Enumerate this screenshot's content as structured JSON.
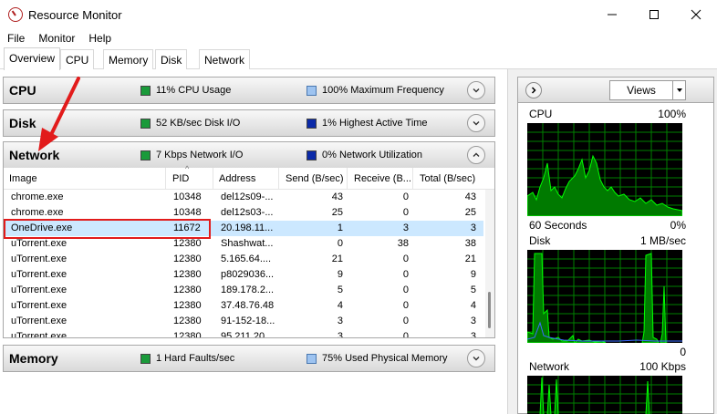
{
  "window": {
    "title": "Resource Monitor",
    "minimize_icon": "minimize-icon",
    "maximize_icon": "maximize-icon",
    "close_icon": "close-icon"
  },
  "menu": [
    "File",
    "Monitor",
    "Help"
  ],
  "tabs": [
    "Overview",
    "CPU",
    "Memory",
    "Disk",
    "Network"
  ],
  "sections": {
    "cpu": {
      "name": "CPU",
      "ind1": "11% CPU Usage",
      "ind2": "100% Maximum Frequency"
    },
    "disk": {
      "name": "Disk",
      "ind1": "52 KB/sec Disk I/O",
      "ind2": "1% Highest Active Time"
    },
    "network": {
      "name": "Network",
      "ind1": "7 Kbps Network I/O",
      "ind2": "0% Network Utilization"
    },
    "memory": {
      "name": "Memory",
      "ind1": "1 Hard Faults/sec",
      "ind2": "75% Used Physical Memory"
    }
  },
  "network_table": {
    "columns": [
      "Image",
      "PID",
      "Address",
      "Send (B/sec)",
      "Receive (B...",
      "Total (B/sec)"
    ],
    "rows": [
      [
        "chrome.exe",
        "10348",
        "del12s09-...",
        "43",
        "0",
        "43"
      ],
      [
        "chrome.exe",
        "10348",
        "del12s03-...",
        "25",
        "0",
        "25"
      ],
      [
        "OneDrive.exe",
        "11672",
        "20.198.11...",
        "1",
        "3",
        "3"
      ],
      [
        "uTorrent.exe",
        "12380",
        "Shashwat...",
        "0",
        "38",
        "38"
      ],
      [
        "uTorrent.exe",
        "12380",
        "5.165.64....",
        "21",
        "0",
        "21"
      ],
      [
        "uTorrent.exe",
        "12380",
        "p8029036...",
        "9",
        "0",
        "9"
      ],
      [
        "uTorrent.exe",
        "12380",
        "189.178.2...",
        "5",
        "0",
        "5"
      ],
      [
        "uTorrent.exe",
        "12380",
        "37.48.76.48",
        "4",
        "0",
        "4"
      ],
      [
        "uTorrent.exe",
        "12380",
        "91-152-18...",
        "3",
        "0",
        "3"
      ],
      [
        "uTorrent.exe",
        "12380",
        "95.211.20...",
        "3",
        "0",
        "3"
      ]
    ],
    "selected_row": 2
  },
  "right_panel": {
    "views_label": "Views",
    "graphs": [
      {
        "name": "CPU",
        "max": "100%",
        "bottom_left": "60 Seconds",
        "bottom_right": "0%"
      },
      {
        "name": "Disk",
        "max": "1 MB/sec",
        "bottom_left": "",
        "bottom_right": "0"
      },
      {
        "name": "Network",
        "max": "100 Kbps",
        "bottom_left": "",
        "bottom_right": ""
      }
    ]
  },
  "colors": {
    "graph_bg": "#000000",
    "graph_grid": "#008000",
    "graph_line": "#00ff00",
    "graph_fill": "#007a00",
    "highlight_red": "#e21b1b"
  }
}
